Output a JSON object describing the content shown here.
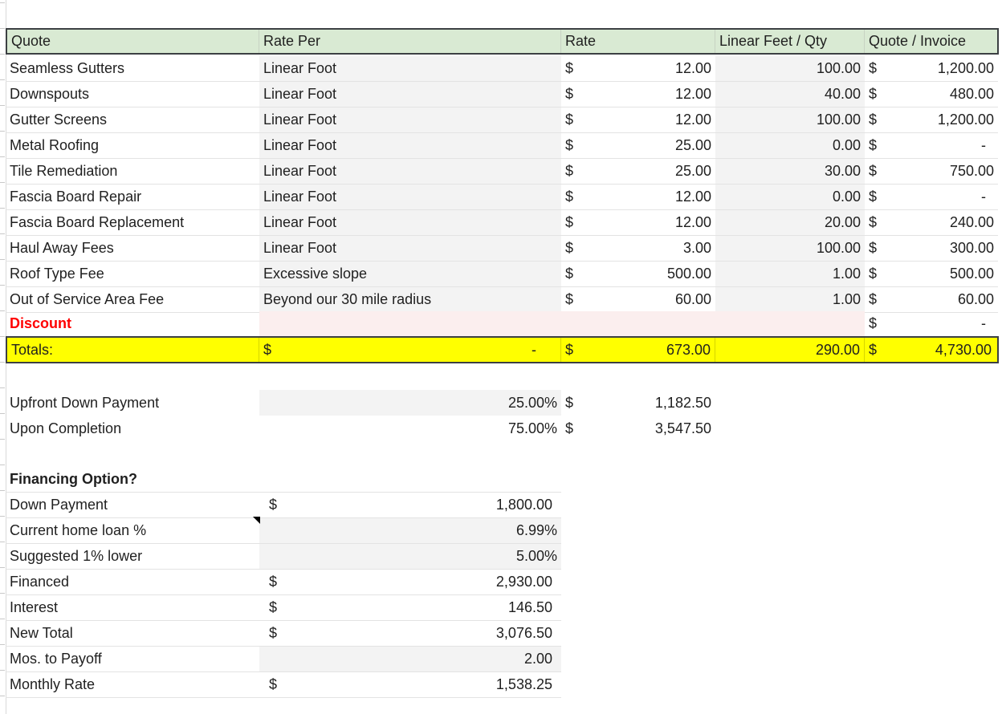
{
  "header": {
    "quote": "Quote",
    "rate_per": "Rate Per",
    "rate": "Rate",
    "linear_feet_qty": "Linear Feet / Qty",
    "quote_invoice": "Quote / Invoice"
  },
  "currency_symbol": "$",
  "items": [
    {
      "name": "Seamless Gutters",
      "rate_per": "Linear Foot",
      "rate": "12.00",
      "qty": "100.00",
      "total": "1,200.00"
    },
    {
      "name": "Downspouts",
      "rate_per": "Linear Foot",
      "rate": "12.00",
      "qty": "40.00",
      "total": "480.00"
    },
    {
      "name": "Gutter Screens",
      "rate_per": "Linear Foot",
      "rate": "12.00",
      "qty": "100.00",
      "total": "1,200.00"
    },
    {
      "name": "Metal Roofing",
      "rate_per": "Linear Foot",
      "rate": "25.00",
      "qty": "0.00",
      "total": "-"
    },
    {
      "name": "Tile Remediation",
      "rate_per": "Linear Foot",
      "rate": "25.00",
      "qty": "30.00",
      "total": "750.00"
    },
    {
      "name": "Fascia Board Repair",
      "rate_per": "Linear Foot",
      "rate": "12.00",
      "qty": "0.00",
      "total": "-"
    },
    {
      "name": "Fascia Board Replacement",
      "rate_per": "Linear Foot",
      "rate": "12.00",
      "qty": "20.00",
      "total": "240.00"
    },
    {
      "name": "Haul Away Fees",
      "rate_per": "Linear Foot",
      "rate": "3.00",
      "qty": "100.00",
      "total": "300.00"
    },
    {
      "name": "Roof Type Fee",
      "rate_per": "Excessive slope",
      "rate": "500.00",
      "qty": "1.00",
      "total": "500.00"
    },
    {
      "name": "Out of Service Area Fee",
      "rate_per": "Beyond our 30 mile radius",
      "rate": "60.00",
      "qty": "1.00",
      "total": "60.00"
    }
  ],
  "discount": {
    "label": "Discount",
    "total": "-"
  },
  "totals": {
    "label": "Totals:",
    "rate_per_total": "-",
    "rate_total": "673.00",
    "qty_total": "290.00",
    "grand_total": "4,730.00"
  },
  "payments": {
    "upfront": {
      "label": "Upfront Down Payment",
      "percent": "25.00%",
      "amount": "1,182.50"
    },
    "completion": {
      "label": "Upon Completion",
      "percent": "75.00%",
      "amount": "3,547.50"
    }
  },
  "financing": {
    "title": "Financing Option?",
    "rows": [
      {
        "label": "Down Payment",
        "dollar": "$",
        "value": "1,800.00",
        "shaded": false
      },
      {
        "label": "Current home loan %",
        "dollar": "",
        "value": "6.99%",
        "shaded": true
      },
      {
        "label": "Suggested 1% lower",
        "dollar": "",
        "value": "5.00%",
        "shaded": true
      },
      {
        "label": "Financed",
        "dollar": "$",
        "value": "2,930.00",
        "shaded": false
      },
      {
        "label": "Interest",
        "dollar": "$",
        "value": "146.50",
        "shaded": false
      },
      {
        "label": "New Total",
        "dollar": "$",
        "value": "3,076.50",
        "shaded": false
      },
      {
        "label": "Mos. to Payoff",
        "dollar": "",
        "value": "2.00",
        "shaded": true
      },
      {
        "label": "Monthly Rate",
        "dollar": "$",
        "value": "1,538.25",
        "shaded": false
      }
    ]
  }
}
